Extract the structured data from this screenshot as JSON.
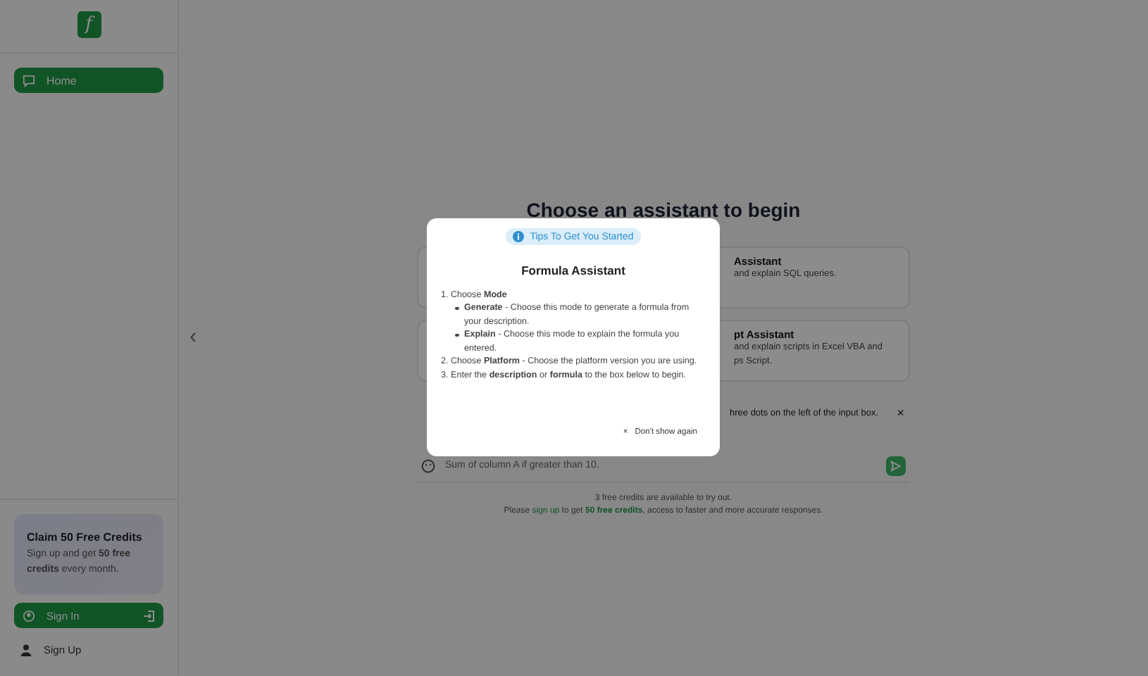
{
  "sidebar": {
    "logo": "f",
    "nav": [
      {
        "label": "Home",
        "selected": true
      }
    ],
    "promo": {
      "title": "Claim 50 Free Credits",
      "text": "Sign up and get **50 free credits** every month."
    },
    "sign_in": "Sign In",
    "sign_up": "Sign Up"
  },
  "main": {
    "title": "Choose an assistant to begin",
    "cards": [
      {
        "title": "Assistant",
        "lines": [
          "and explain SQL queries."
        ]
      },
      {
        "title": "pt Assistant",
        "lines": [
          "and explain scripts in Excel VBA and",
          "ps Script."
        ]
      }
    ],
    "notice": "hree dots on the left of the input box.",
    "notice_close": "×",
    "input": {
      "placeholder": "Sum of column A if greater than 10."
    },
    "credits_line": "3 free credits are available to try out.",
    "signup_line": {
      "before": "Please",
      "link": "sign up",
      "middle": "to get",
      "bold": "50 free credits",
      "after": ", access to faster and more accurate responses."
    }
  },
  "modal": {
    "badge": "Tips To Get You Started",
    "title": "Formula Assistant",
    "steps": [
      {
        "text": "1. Choose **Mode**",
        "children": [
          {
            "text": "**Generate** - Choose this mode to generate a formula from your description."
          },
          {
            "text": "**Explain** - Choose this mode to explain the formula you entered."
          }
        ]
      },
      {
        "text": "2. Choose **Platform** - Choose the platform version you are using."
      },
      {
        "text": "3. Enter the **description** or **formula** to the box below to begin."
      }
    ],
    "dismiss_icon": "×",
    "dismiss": "Don't show again"
  }
}
